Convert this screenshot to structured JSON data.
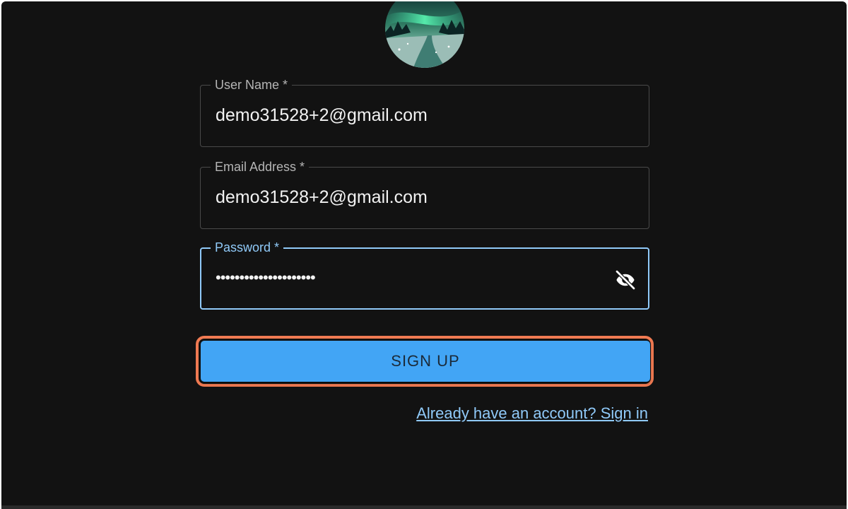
{
  "avatar": {
    "description": "aurora-landscape-image"
  },
  "form": {
    "username": {
      "label": "User Name *",
      "value": "demo31528+2@gmail.com"
    },
    "email": {
      "label": "Email Address *",
      "value": "demo31528+2@gmail.com"
    },
    "password": {
      "label": "Password *",
      "value": "•••••••••••••••••••••",
      "visibility_icon": "eye-off-icon"
    },
    "submit_label": "SIGN UP",
    "signin_link": "Already have an account? Sign in"
  },
  "colors": {
    "background": "#121212",
    "accent": "#42a5f5",
    "focus": "#90caf9",
    "highlight": "#f07a52"
  }
}
